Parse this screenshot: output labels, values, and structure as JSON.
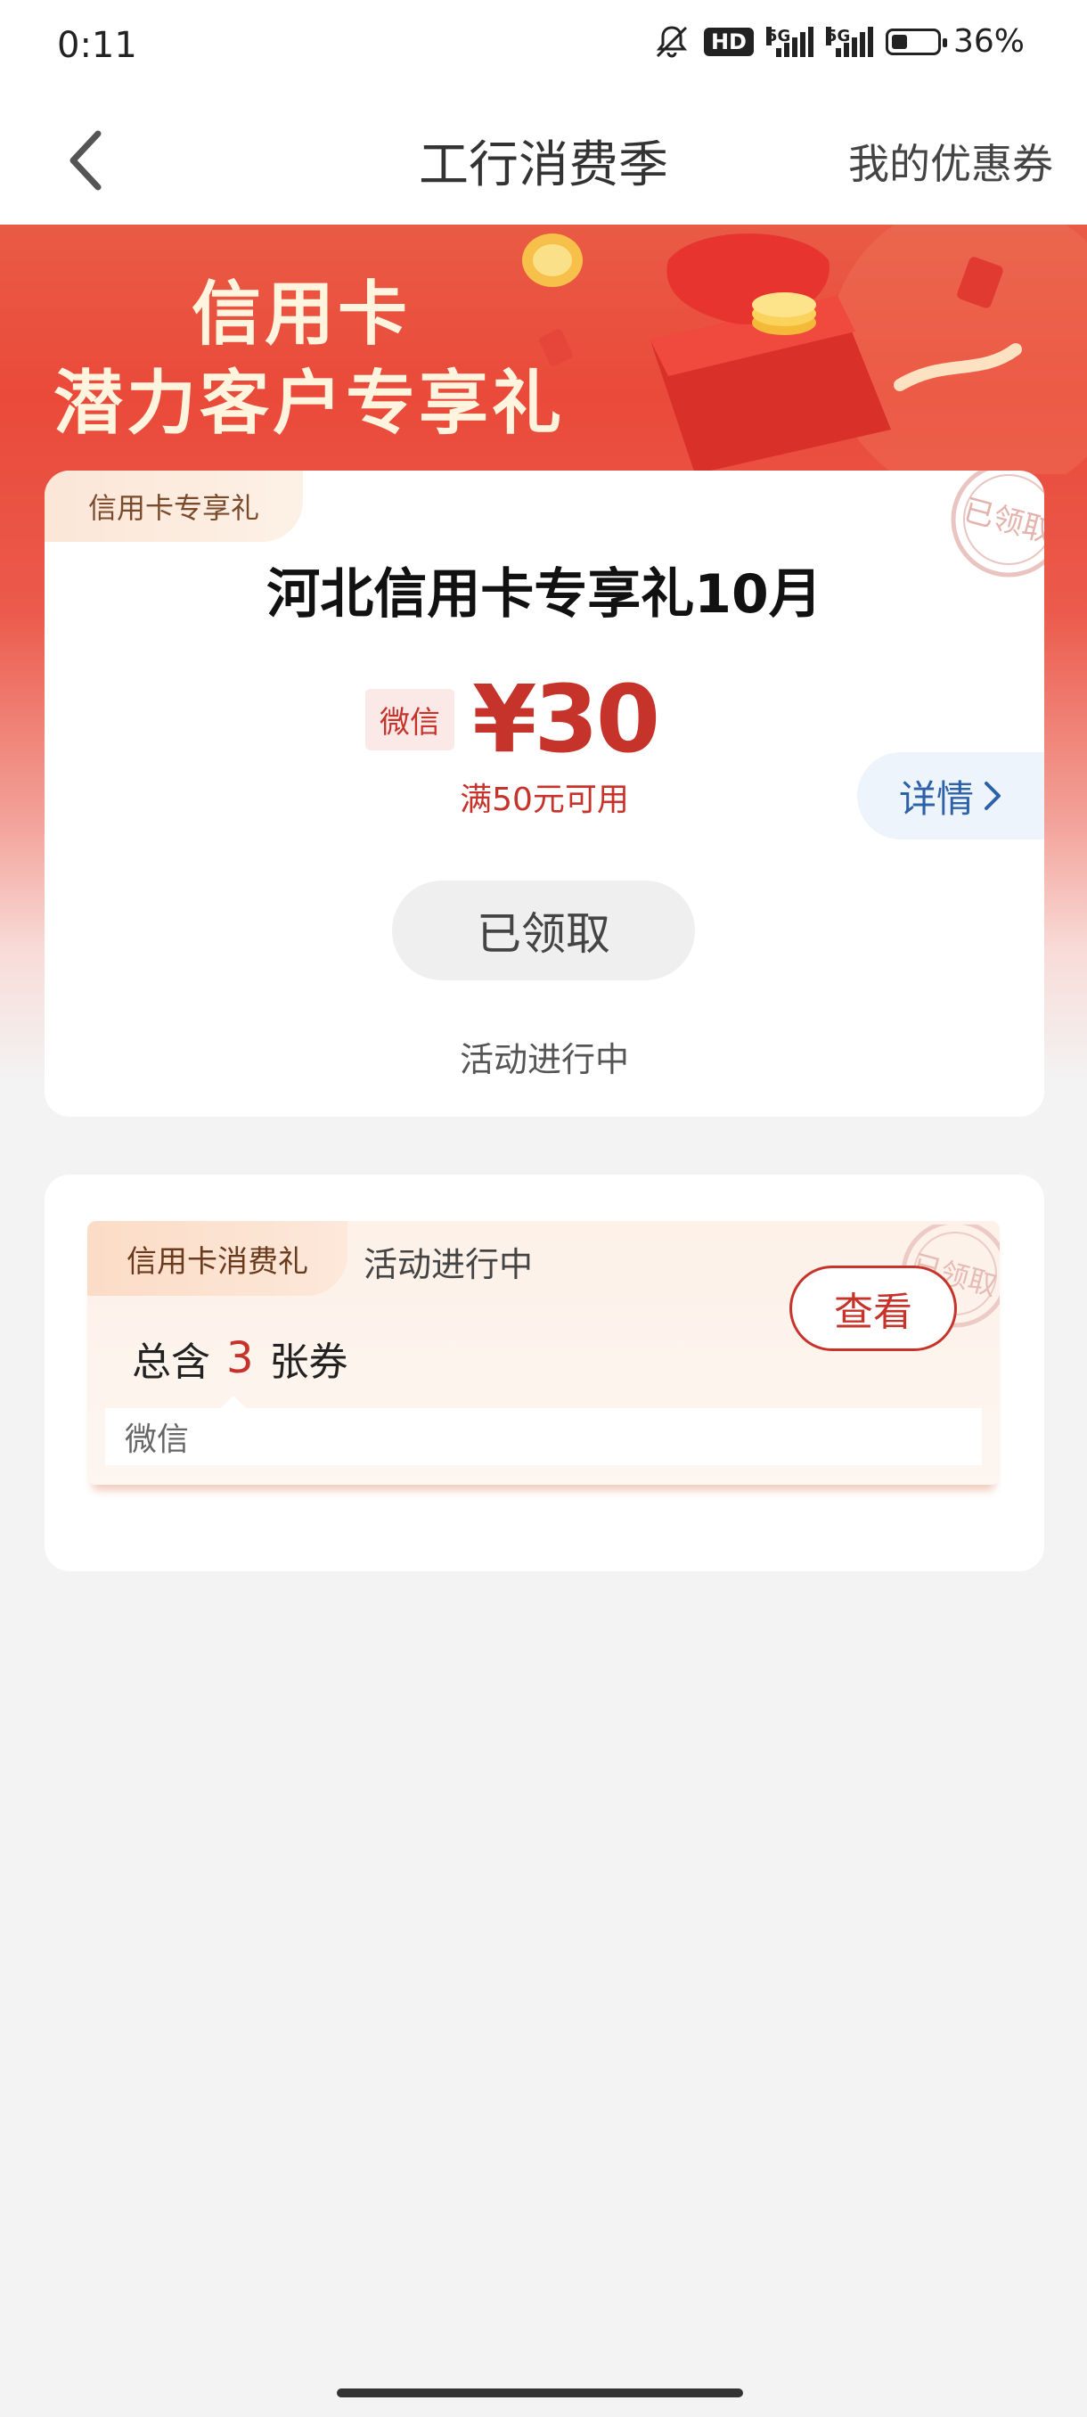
{
  "status_bar": {
    "time": "0:11",
    "hd_label": "HD",
    "net1": "5G",
    "net2": "5G",
    "battery_level": 0.36,
    "battery_text": "36%"
  },
  "nav": {
    "title": "工行消费季",
    "right_link": "我的优惠券",
    "back_icon": "chevron-left-icon"
  },
  "banner": {
    "line1": "信用卡",
    "line2": "潜力客户专享礼"
  },
  "card1": {
    "tag": "信用卡专享礼",
    "stamp": "已领取",
    "title": "河北信用卡专享礼10月",
    "channel": "微信",
    "amount": "¥30",
    "condition": "满50元可用",
    "detail": "详情",
    "button": "已领取",
    "status": "活动进行中"
  },
  "card2": {
    "tag": "信用卡消费礼",
    "status": "活动进行中",
    "stamp": "已领取",
    "view": "查看",
    "total_prefix": "总含",
    "total_count": "3",
    "total_suffix": "张券",
    "channel": "微信"
  },
  "colors": {
    "accent_red": "#c6332a",
    "banner_red": "#ea4a3a",
    "link_blue": "#2d62a8",
    "background": "#f3f3f3"
  }
}
